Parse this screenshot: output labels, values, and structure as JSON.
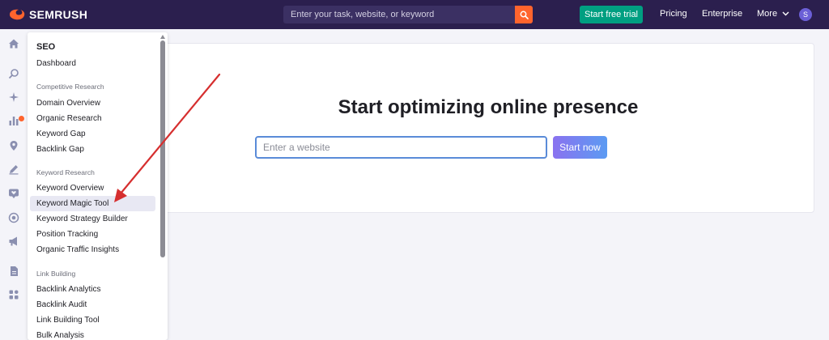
{
  "header": {
    "brand": "SEMRUSH",
    "search_placeholder": "Enter your task, website, or keyword",
    "trial_label": "Start free trial",
    "pricing_label": "Pricing",
    "enterprise_label": "Enterprise",
    "more_label": "More",
    "avatar_initial": "S"
  },
  "rail": {
    "icons": [
      "home-icon",
      "seo-icon",
      "ai-sparkle-icon",
      "bar-chart-icon",
      "location-pin-icon",
      "pencil-icon",
      "heart-chat-icon",
      "target-icon",
      "megaphone-icon",
      "document-icon",
      "apps-grid-icon"
    ]
  },
  "menu": {
    "header": "SEO",
    "dashboard": "Dashboard",
    "sections": [
      {
        "title": "Competitive Research",
        "items": [
          "Domain Overview",
          "Organic Research",
          "Keyword Gap",
          "Backlink Gap"
        ]
      },
      {
        "title": "Keyword Research",
        "items": [
          "Keyword Overview",
          "Keyword Magic Tool",
          "Keyword Strategy Builder",
          "Position Tracking",
          "Organic Traffic Insights"
        ]
      },
      {
        "title": "Link Building",
        "items": [
          "Backlink Analytics",
          "Backlink Audit",
          "Link Building Tool",
          "Bulk Analysis"
        ]
      }
    ],
    "active_item": "Keyword Magic Tool"
  },
  "main": {
    "title": "Start optimizing online presence",
    "input_placeholder": "Enter a website",
    "start_label": "Start now"
  },
  "colors": {
    "topbar": "#2b1f4e",
    "accent_orange": "#ff642d",
    "trial_green": "#009f81",
    "annotation_arrow": "#d62f2f"
  }
}
